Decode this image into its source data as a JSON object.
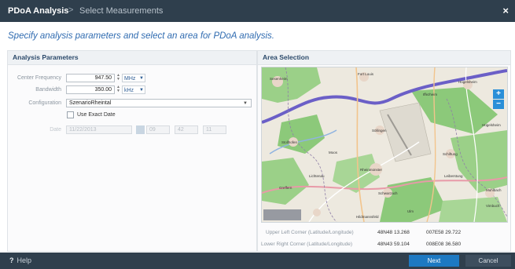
{
  "window": {
    "title": "PDoA Analysis",
    "separator": ">",
    "subtitle": "Select Measurements",
    "close": "×"
  },
  "headline": "Specify analysis parameters and select an area for PDoA analysis.",
  "params": {
    "heading": "Analysis Parameters",
    "center_frequency": {
      "label": "Center Frequency",
      "value": "947.50",
      "unit": "MHz"
    },
    "bandwidth": {
      "label": "Bandwidth",
      "value": "350.00",
      "unit": "kHz"
    },
    "configuration": {
      "label": "Configuration",
      "value": "SzenarioRheintal"
    },
    "use_exact_date": {
      "label": "Use Exact Date",
      "checked": false
    },
    "date": {
      "label": "Date",
      "value": "11/22/2013",
      "hour": "09",
      "minute": "42",
      "second": "11"
    }
  },
  "area": {
    "heading": "Area Selection",
    "map_labels": {
      "l1": "Sesenheim",
      "l2": "Fort Louis",
      "l3": "Hügelsheim",
      "l4": "Iffezheim",
      "l5": "Söllingen",
      "l6": "Stollhofen",
      "l7": "Schiftung",
      "l8": "Hügelsheim",
      "l9": "Rheinmünster",
      "l10": "Lichtenau",
      "l11": "Schwarzach",
      "l12": "Leiberstung",
      "l13": "Muhlbach",
      "l14": "Vimbuch",
      "l15": "Greffern",
      "l16": "Hildmannsfeld",
      "l17": "Ulm",
      "l18": "Moos"
    },
    "zoom_in": "+",
    "zoom_out": "−",
    "upper_left": {
      "label": "Upper Left Corner (Latitude/Longitude)",
      "lat": "48N48 13.268",
      "lon": "007E58 29.722"
    },
    "lower_right": {
      "label": "Lower Right Corner (Latitude/Longitude)",
      "lat": "48N43 59.104",
      "lon": "008E08 36.580"
    }
  },
  "footer": {
    "help_icon": "?",
    "help": "Help",
    "next": "Next",
    "cancel": "Cancel"
  },
  "colors": {
    "titlebar": "#2f3f4d",
    "accent": "#1d79c2",
    "headline": "#2f6bb0",
    "river": "#6b5fc7",
    "forest": "#8cc97a",
    "road_major": "#e89aa8"
  }
}
